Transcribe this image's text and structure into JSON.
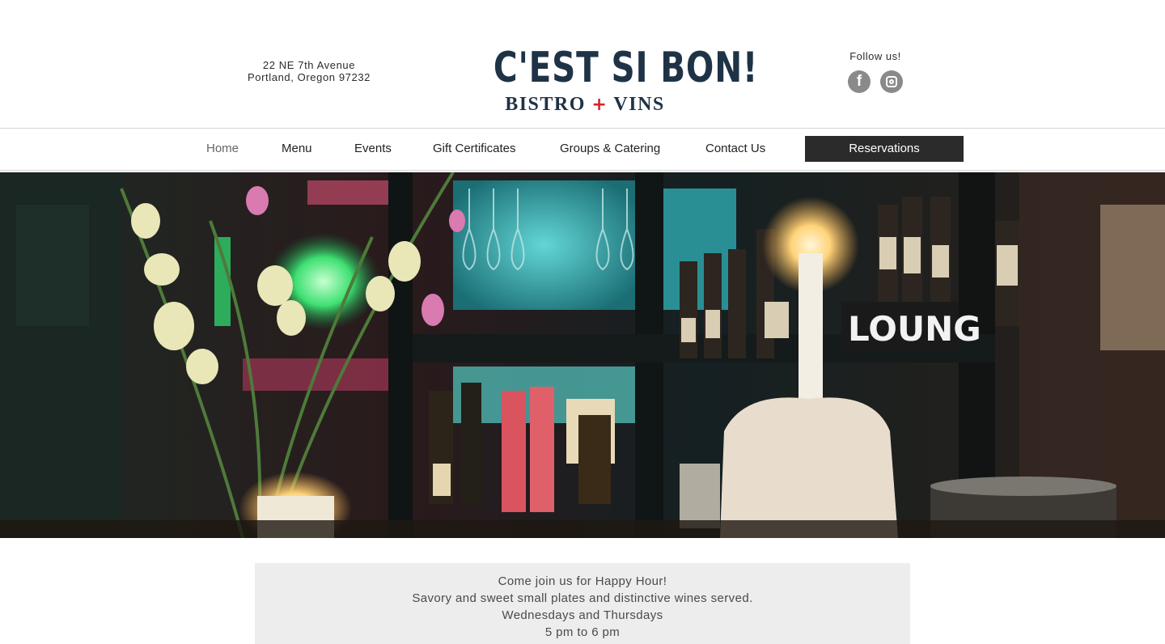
{
  "address": {
    "line1": "22 NE 7th Avenue",
    "line2": "Portland, Oregon 97232"
  },
  "logo": {
    "main": "C'EST SI BON!",
    "sub_left": "BISTRO",
    "sub_cross": "+",
    "sub_right": "VINS",
    "color": "#1f3346",
    "accent": "#d4242a"
  },
  "social": {
    "label": "Follow us!",
    "icons": [
      "facebook-icon",
      "instagram-icon"
    ]
  },
  "nav": {
    "items": [
      {
        "label": "Home",
        "active": true
      },
      {
        "label": "Menu"
      },
      {
        "label": "Events"
      },
      {
        "label": "Gift Certificates"
      },
      {
        "label": "Groups & Catering"
      },
      {
        "label": "Contact Us"
      }
    ],
    "reservations": "Reservations"
  },
  "hero": {
    "sign_text": "LOUNG"
  },
  "promo": {
    "line1": "Come join us for Happy Hour!",
    "line2": "Savory and sweet small plates and distinctive wines served.",
    "line3": "Wednesdays and Thursdays",
    "line4": "5 pm to 6 pm"
  }
}
